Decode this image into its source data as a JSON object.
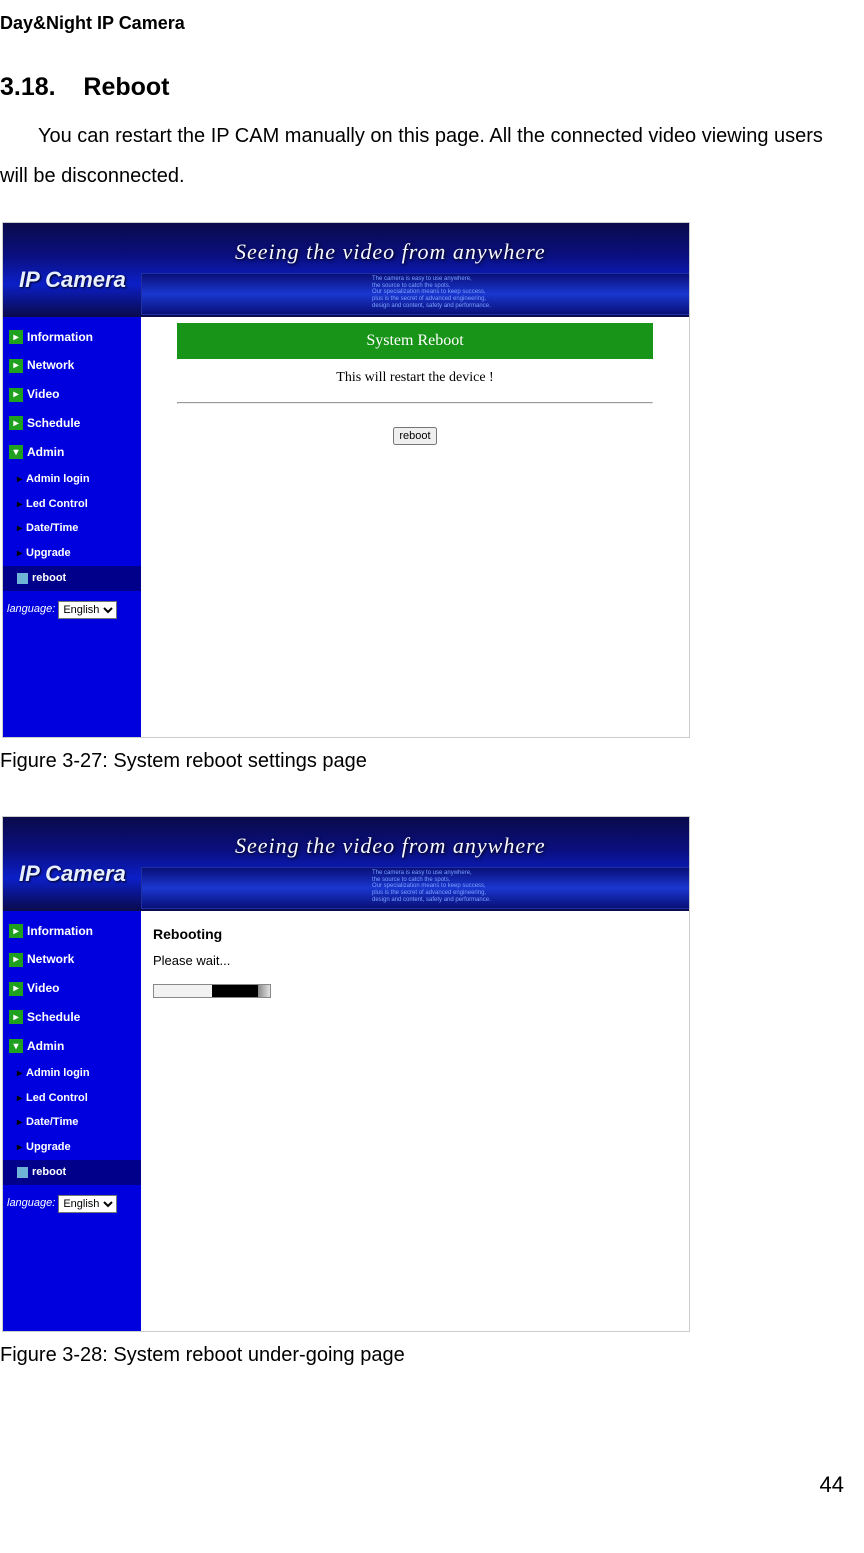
{
  "doc": {
    "header": "Day&Night IP Camera",
    "section_number": "3.18.",
    "section_title": "Reboot",
    "body": "You can restart the IP CAM manually on this page. All the connected video viewing users will be disconnected.",
    "caption1": "Figure 3-27: System reboot settings page",
    "caption2": "Figure 3-28: System reboot under-going page",
    "page_number": "44"
  },
  "ui": {
    "logo": "IP Camera",
    "tagline": "Seeing the video from anywhere",
    "sidebar": {
      "main": [
        "Information",
        "Network",
        "Video",
        "Schedule",
        "Admin"
      ],
      "sub": [
        "Admin login",
        "Led Control",
        "Date/Time",
        "Upgrade",
        "reboot"
      ],
      "lang_label": "language:",
      "lang_value": "English"
    },
    "panel1": {
      "title": "System Reboot",
      "subtitle": "This will restart the device !",
      "button": "reboot"
    },
    "panel2": {
      "heading": "Rebooting",
      "subtext": "Please wait..."
    }
  }
}
